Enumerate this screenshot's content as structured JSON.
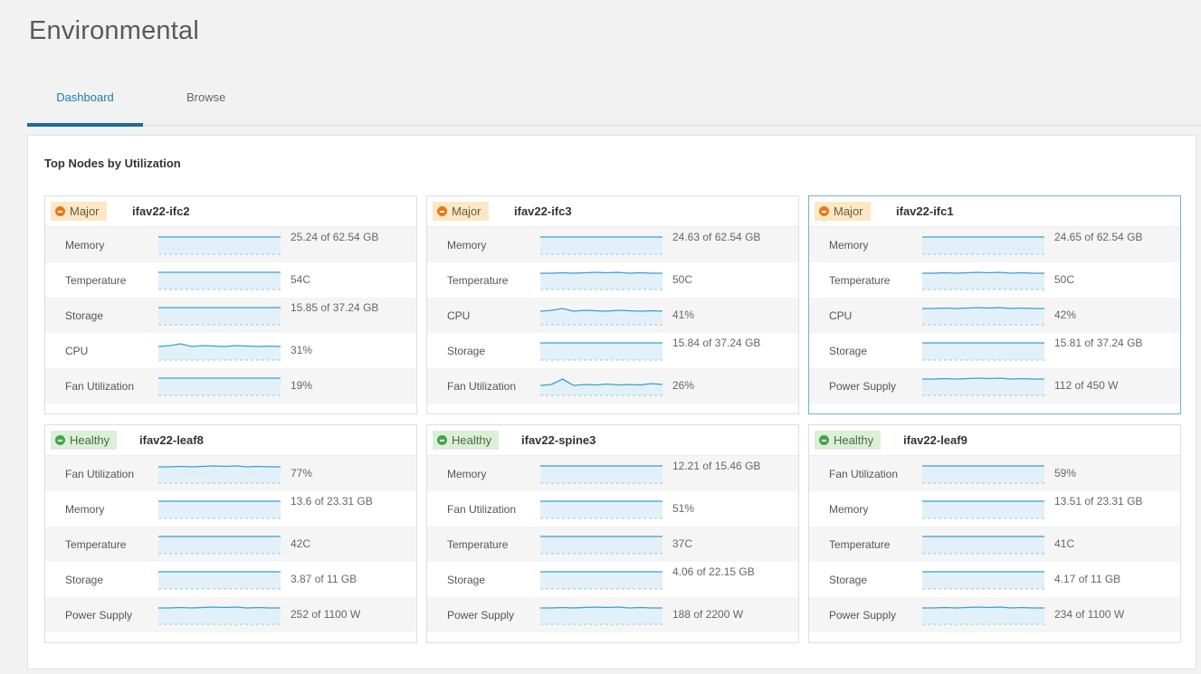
{
  "page": {
    "title": "Environmental"
  },
  "tabs": [
    {
      "label": "Dashboard",
      "active": true
    },
    {
      "label": "Browse",
      "active": false
    }
  ],
  "panel": {
    "title": "Top Nodes by Utilization"
  },
  "colors": {
    "accent": "#1a7fae",
    "sparkline": "#3a9fd0",
    "sparkline_fill": "#e2f1f9",
    "major": "#e57a1a",
    "healthy": "#47a447"
  },
  "nodes": [
    {
      "status": "Major",
      "status_type": "major",
      "name": "ifav22-ifc2",
      "selected": false,
      "metrics": [
        {
          "label": "Memory",
          "value": "25.24 of 62.54 GB",
          "trend": "flat"
        },
        {
          "label": "Temperature",
          "value": "54C",
          "trend": "flat"
        },
        {
          "label": "Storage",
          "value": "15.85 of 37.24 GB",
          "trend": "flat"
        },
        {
          "label": "CPU",
          "value": "31%",
          "trend": "wave"
        },
        {
          "label": "Fan Utilization",
          "value": "19%",
          "trend": "flat"
        }
      ]
    },
    {
      "status": "Major",
      "status_type": "major",
      "name": "ifav22-ifc3",
      "selected": false,
      "metrics": [
        {
          "label": "Memory",
          "value": "24.63 of 62.54 GB",
          "trend": "flat"
        },
        {
          "label": "Temperature",
          "value": "50C",
          "trend": "slight"
        },
        {
          "label": "CPU",
          "value": "41%",
          "trend": "wave"
        },
        {
          "label": "Storage",
          "value": "15.84 of 37.24 GB",
          "trend": "flat"
        },
        {
          "label": "Fan Utilization",
          "value": "26%",
          "trend": "spike"
        }
      ]
    },
    {
      "status": "Major",
      "status_type": "major",
      "name": "ifav22-ifc1",
      "selected": true,
      "metrics": [
        {
          "label": "Memory",
          "value": "24.65 of 62.54 GB",
          "trend": "flat"
        },
        {
          "label": "Temperature",
          "value": "50C",
          "trend": "slight"
        },
        {
          "label": "CPU",
          "value": "42%",
          "trend": "slight"
        },
        {
          "label": "Storage",
          "value": "15.81 of 37.24 GB",
          "trend": "flat"
        },
        {
          "label": "Power Supply",
          "value": "112 of 450 W",
          "trend": "slight"
        }
      ]
    },
    {
      "status": "Healthy",
      "status_type": "healthy",
      "name": "ifav22-leaf8",
      "selected": false,
      "metrics": [
        {
          "label": "Fan Utilization",
          "value": "77%",
          "trend": "slight"
        },
        {
          "label": "Memory",
          "value": "13.6 of 23.31 GB",
          "trend": "flat"
        },
        {
          "label": "Temperature",
          "value": "42C",
          "trend": "flat"
        },
        {
          "label": "Storage",
          "value": "3.87 of 11 GB",
          "trend": "flat"
        },
        {
          "label": "Power Supply",
          "value": "252 of 1100 W",
          "trend": "slight"
        }
      ]
    },
    {
      "status": "Healthy",
      "status_type": "healthy",
      "name": "ifav22-spine3",
      "selected": false,
      "metrics": [
        {
          "label": "Memory",
          "value": "12.21 of 15.46 GB",
          "trend": "flat"
        },
        {
          "label": "Fan Utilization",
          "value": "51%",
          "trend": "flat"
        },
        {
          "label": "Temperature",
          "value": "37C",
          "trend": "flat"
        },
        {
          "label": "Storage",
          "value": "4.06 of 22.15 GB",
          "trend": "flat"
        },
        {
          "label": "Power Supply",
          "value": "188 of 2200 W",
          "trend": "slight"
        }
      ]
    },
    {
      "status": "Healthy",
      "status_type": "healthy",
      "name": "ifav22-leaf9",
      "selected": false,
      "metrics": [
        {
          "label": "Fan Utilization",
          "value": "59%",
          "trend": "flat"
        },
        {
          "label": "Memory",
          "value": "13.51 of 23.31 GB",
          "trend": "flat"
        },
        {
          "label": "Temperature",
          "value": "41C",
          "trend": "flat"
        },
        {
          "label": "Storage",
          "value": "4.17 of 11 GB",
          "trend": "flat"
        },
        {
          "label": "Power Supply",
          "value": "234 of 1100 W",
          "trend": "slight"
        }
      ]
    }
  ]
}
